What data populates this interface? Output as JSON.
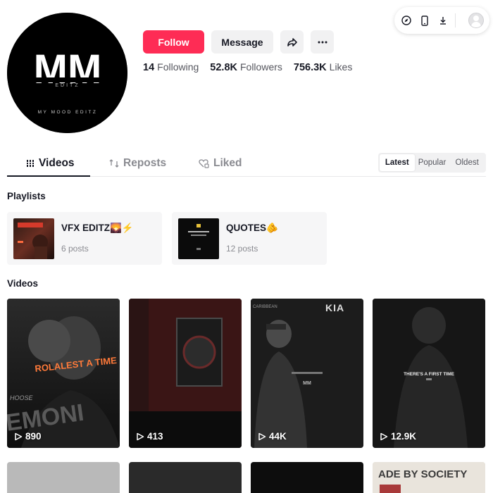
{
  "profile": {
    "avatar": {
      "logo_text": "MM",
      "sub_text": "EDITZ",
      "tagline": "MY MOOD EDITZ"
    },
    "actions": {
      "follow_label": "Follow",
      "message_label": "Message",
      "share_icon": "share-icon",
      "more_icon": "more-icon"
    },
    "stats": [
      {
        "value": "14",
        "label": "Following"
      },
      {
        "value": "52.8K",
        "label": "Followers"
      },
      {
        "value": "756.3K",
        "label": "Likes"
      }
    ]
  },
  "toolbar": {
    "icons": [
      "compass-icon",
      "phone-icon",
      "download-icon",
      "user-avatar"
    ]
  },
  "tabs": [
    {
      "label": "Videos",
      "icon": "grid-icon",
      "active": true
    },
    {
      "label": "Reposts",
      "icon": "repost-icon",
      "active": false
    },
    {
      "label": "Liked",
      "icon": "heart-lock-icon",
      "active": false
    }
  ],
  "sort": {
    "options": [
      "Latest",
      "Popular",
      "Oldest"
    ],
    "selected": "Latest"
  },
  "playlists": {
    "title": "Playlists",
    "items": [
      {
        "name": "VFX EDITZ🌄⚡",
        "count": "6 posts"
      },
      {
        "name": "QUOTES🫵",
        "count": "12 posts"
      }
    ]
  },
  "videos": {
    "title": "Videos",
    "items": [
      {
        "views": "890",
        "overlay": "ROLALEST A TIME",
        "overlay2": "EMONI",
        "overlay3": "HOOSE"
      },
      {
        "views": "413"
      },
      {
        "views": "44K",
        "overlay": "CARIBBEAN",
        "overlay2": "MM",
        "brand": "KIA"
      },
      {
        "views": "12.9K",
        "overlay": "THERE'S A FIRST TIME"
      }
    ],
    "row2_overlay": "ADE BY SOCIETY"
  },
  "colors": {
    "accent": "#fe2c55",
    "text": "#161823",
    "muted": "#8a8b91",
    "chip_bg": "#f1f1f2"
  }
}
